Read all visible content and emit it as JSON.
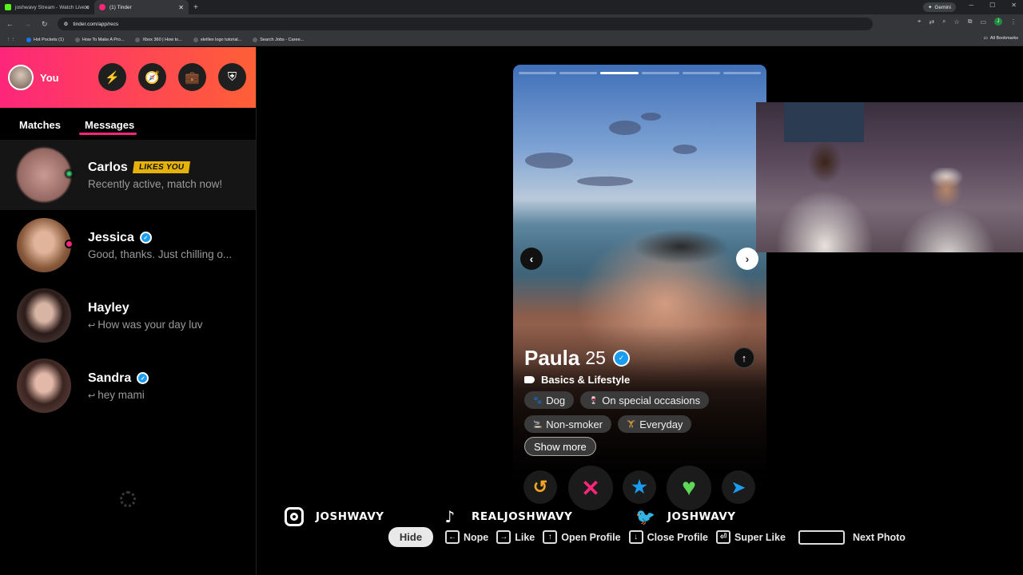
{
  "browser": {
    "tabs": [
      {
        "title": "joshwavy Stream - Watch Live o",
        "favicon_color": "#53fc18",
        "active": false
      },
      {
        "title": "(1) Tinder",
        "favicon_color": "#fd267a",
        "active": true
      }
    ],
    "new_tab": "+",
    "gemini_label": "Gemini",
    "url": "tinder.com/app/recs",
    "bookmarks": [
      "Hot Pockets (1)",
      "How To Make A Pro...",
      "Xbox 360 | How to...",
      "skrillex logo tutorial...",
      "Search Jobs - Caree..."
    ],
    "all_bookmarks": "All Bookmarks",
    "profile_initial": "J"
  },
  "sidebar": {
    "you_label": "You",
    "tabs": [
      "Matches",
      "Messages"
    ],
    "conversations": [
      {
        "name": "Carlos",
        "badge": "LIKES YOU",
        "message": "Recently active, match now!",
        "status_color": "#3ad07a",
        "verified": false,
        "replied": false
      },
      {
        "name": "Jessica",
        "badge": "",
        "message": "Good, thanks. Just chilling o...",
        "status_color": "#fd267a",
        "verified": true,
        "replied": false
      },
      {
        "name": "Hayley",
        "badge": "",
        "message": "How was your day luv",
        "status_color": "",
        "verified": false,
        "replied": true
      },
      {
        "name": "Sandra",
        "badge": "",
        "message": "hey mami",
        "status_color": "",
        "verified": true,
        "replied": true
      }
    ]
  },
  "profile": {
    "name": "Paula",
    "age": "25",
    "photo_count": 6,
    "current_photo": 3,
    "section_title": "Basics & Lifestyle",
    "chips": [
      {
        "icon": "paw-icon",
        "label": "Dog"
      },
      {
        "icon": "glass-icon",
        "label": "On special occasions"
      },
      {
        "icon": "cigarette-icon",
        "label": "Non-smoker"
      },
      {
        "icon": "dumbbell-icon",
        "label": "Everyday"
      }
    ],
    "show_more": "Show more"
  },
  "actions": {
    "rewind": "↺",
    "nope": "✕",
    "superlike": "★",
    "like": "♥",
    "boost": "➤"
  },
  "overlay": {
    "socials": [
      {
        "icon": "instagram-icon",
        "handle": "JOSHWAVY"
      },
      {
        "icon": "tiktok-icon",
        "handle": "REALJOSHWAVY"
      },
      {
        "icon": "twitter-icon",
        "handle": "JOSHWAVY"
      }
    ],
    "hide": "Hide",
    "shortcuts": [
      {
        "key": "←",
        "label": "Nope"
      },
      {
        "key": "→",
        "label": "Like"
      },
      {
        "key": "↑",
        "label": "Open Profile"
      },
      {
        "key": "↓",
        "label": "Close Profile"
      },
      {
        "key": "⏎",
        "label": "Super Like"
      }
    ],
    "next_photo": "Next Photo"
  },
  "colors": {
    "brand_gradient_start": "#fd267a",
    "brand_gradient_end": "#ff6036",
    "likes_badge": "#e5b20a",
    "verified_blue": "#1a9cf0"
  }
}
